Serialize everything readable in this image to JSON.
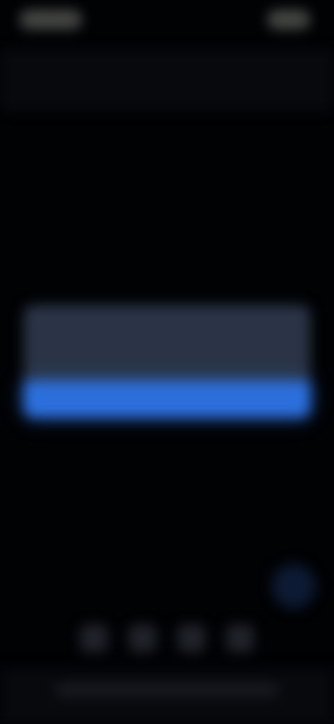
{
  "status_bar": {
    "left_indicator": "",
    "right_indicator": ""
  },
  "dialog": {
    "title": "",
    "message": "",
    "button_label": "",
    "button_color": "#2c6fdc",
    "card_color": "#2a3446"
  },
  "fab": {
    "icon": "circle-icon",
    "color": "#0d1a33"
  },
  "dock": {
    "items": [
      {
        "icon": "app-icon"
      },
      {
        "icon": "app-icon"
      },
      {
        "icon": "app-icon"
      },
      {
        "icon": "app-icon"
      }
    ]
  },
  "colors": {
    "background": "#010204",
    "accent": "#2c6fdc"
  }
}
